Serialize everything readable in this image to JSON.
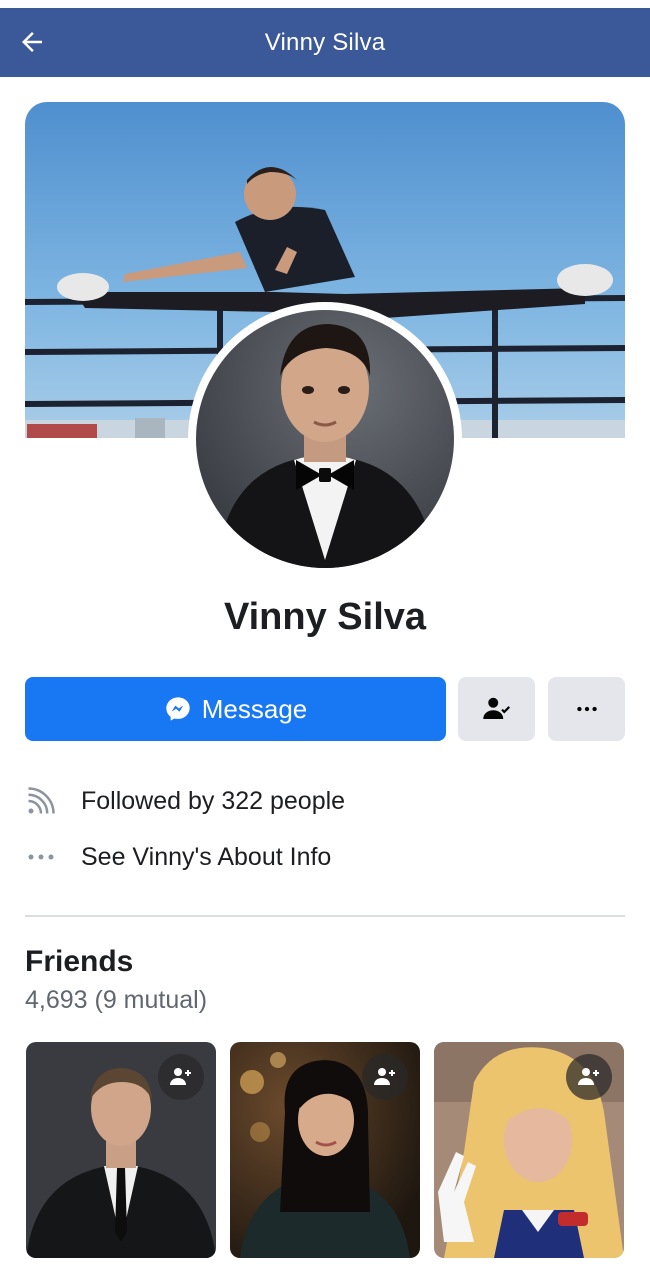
{
  "header": {
    "title": "Vinny Silva",
    "back_icon": "arrow-left-icon",
    "background": "#3b5998"
  },
  "profile": {
    "name": "Vinny Silva"
  },
  "actions": {
    "message_label": "Message",
    "message_icon": "messenger-icon",
    "friend_icon": "friend-check-icon",
    "more_icon": "more-dots-icon",
    "accent": "#1877f2"
  },
  "info": {
    "followers_text": "Followed by 322 people",
    "followers_icon": "rss-icon",
    "about_text": "See Vinny's About Info",
    "about_icon": "more-dots-icon"
  },
  "friends": {
    "title": "Friends",
    "count_text": "4,693 (9 mutual)",
    "add_icon": "add-friend-icon"
  }
}
